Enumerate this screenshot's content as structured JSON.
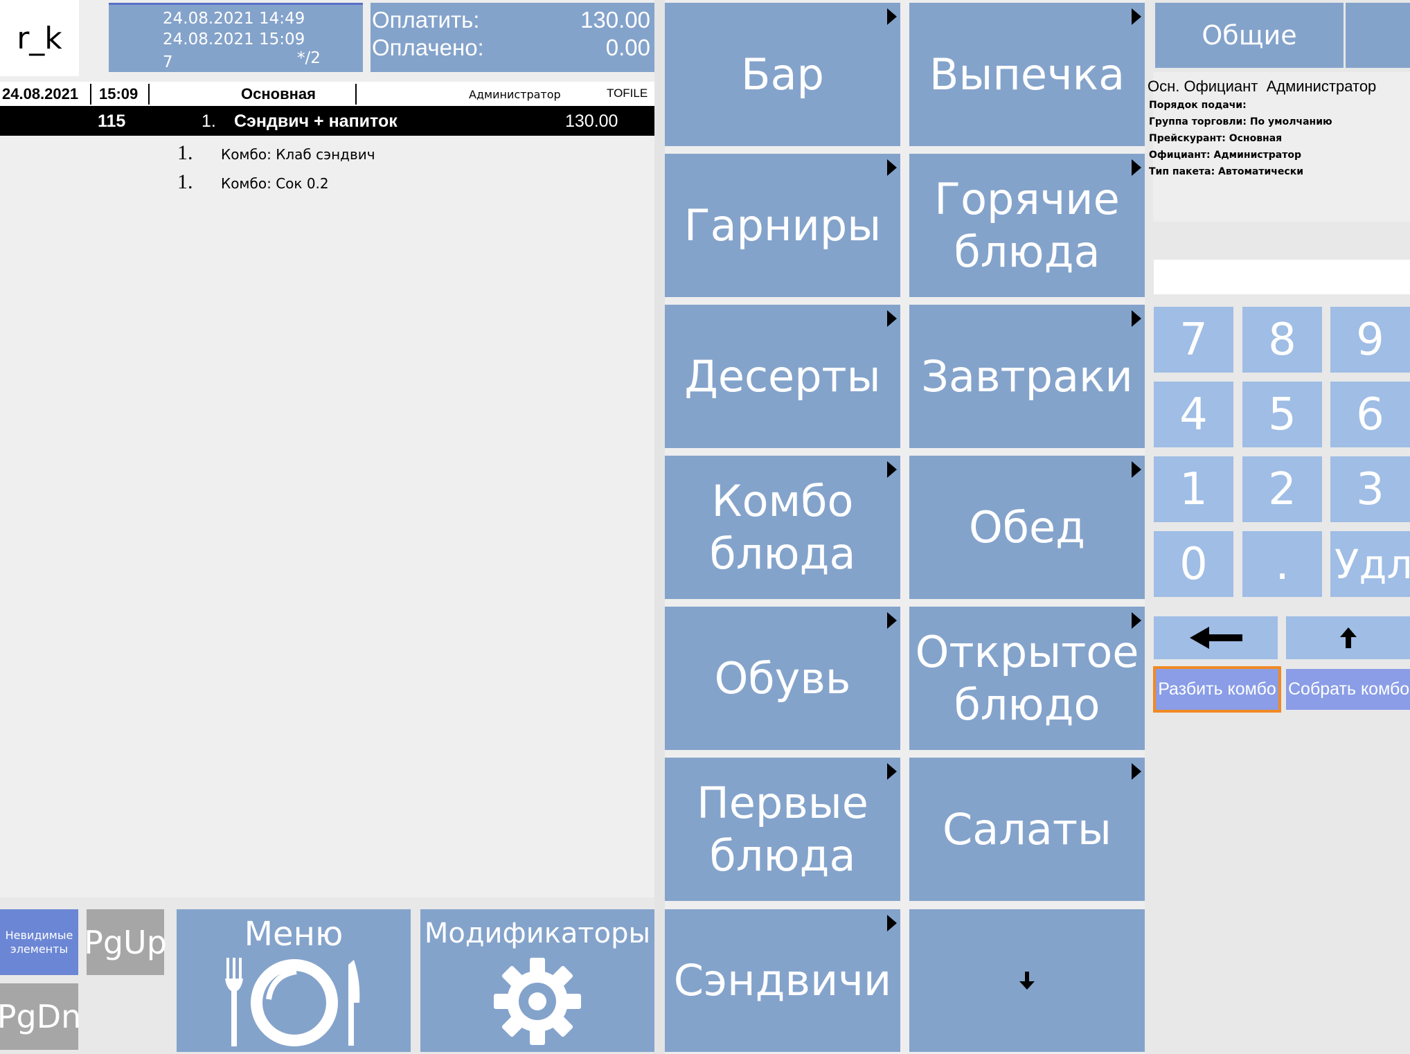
{
  "logo": "r_k",
  "order_info": {
    "opened": "24.08.2021 14:49",
    "updated": "24.08.2021 15:09",
    "guests": "7",
    "table": "*/2"
  },
  "totals": {
    "to_pay_label": "Оплатить:",
    "to_pay_value": "130.00",
    "paid_label": "Оплачено:",
    "paid_value": "0.00"
  },
  "check_header": {
    "date": "24.08.2021",
    "time": "15:09",
    "price_list": "Основная",
    "waiter": "Администратор",
    "station": "TOFILE"
  },
  "order_line": {
    "code": "115",
    "qty": "1.",
    "name": "Сэндвич + напиток",
    "price": "130.00"
  },
  "sub_items": [
    {
      "qty": "1.",
      "name": "Комбо: Клаб сэндвич"
    },
    {
      "qty": "1.",
      "name": "Комбо: Сок 0.2"
    }
  ],
  "bottom_left": {
    "invisible": "Невидимые элементы",
    "pgup": "PgUp",
    "pgdn": "PgDn",
    "menu": "Меню",
    "modifiers": "Модификаторы"
  },
  "categories": [
    {
      "label": "Бар"
    },
    {
      "label": "Выпечка"
    },
    {
      "label": "Гарниры"
    },
    {
      "label": "Горячие\nблюда"
    },
    {
      "label": "Десерты"
    },
    {
      "label": "Завтраки"
    },
    {
      "label": "Комбо\nблюда"
    },
    {
      "label": "Обед"
    },
    {
      "label": "Обувь"
    },
    {
      "label": "Открытое\nблюдо"
    },
    {
      "label": "Первые\nблюда"
    },
    {
      "label": "Салаты"
    },
    {
      "label": "Сэндвичи"
    }
  ],
  "right_panel": {
    "general_tab": "Общие",
    "main_waiter": "Осн. Официант  Администратор",
    "details": [
      "Порядок подачи:",
      "Группа торговли: По умолчанию",
      "Прейскурант: Основная",
      "Официант: Администратор",
      "Тип пакета: Автоматически"
    ],
    "keys": [
      "7",
      "8",
      "9",
      "4",
      "5",
      "6",
      "1",
      "2",
      "3",
      "0",
      ".",
      "Удл"
    ],
    "split_combo": "Разбить комбо",
    "assemble_combo": "Собрать комбо"
  },
  "colors": {
    "tile": "#84a3cb",
    "key": "#9fbde5",
    "highlight": "#f08a24",
    "selected_row": "#000000",
    "gray_button": "#a6a6a6"
  },
  "icons": {
    "menu": "fork-plate-knife-icon",
    "modifiers": "gear-icon",
    "back": "arrow-left-icon",
    "up": "arrow-up-icon",
    "down": "arrow-down-icon",
    "submenu": "triangle-right-icon"
  }
}
